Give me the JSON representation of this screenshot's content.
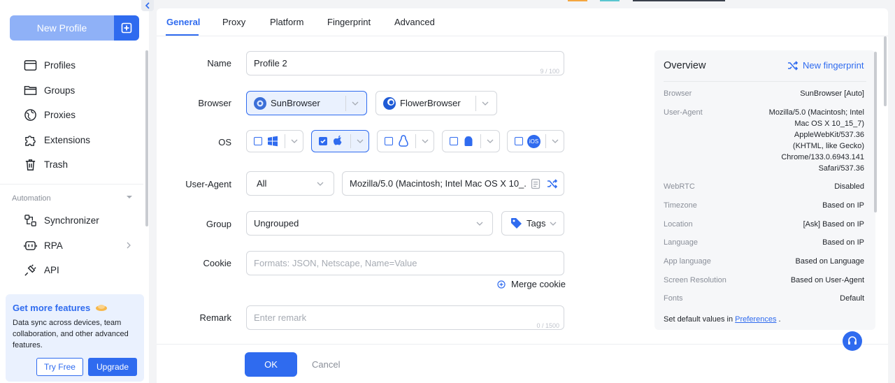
{
  "sidebar": {
    "new_profile_label": "New Profile",
    "items": [
      {
        "label": "Profiles",
        "icon": "browser-window-icon"
      },
      {
        "label": "Groups",
        "icon": "folder-icon"
      },
      {
        "label": "Proxies",
        "icon": "globe-icon"
      },
      {
        "label": "Extensions",
        "icon": "puzzle-icon"
      },
      {
        "label": "Trash",
        "icon": "trash-icon"
      }
    ],
    "automation_label": "Automation",
    "automation_items": [
      {
        "label": "Synchronizer",
        "icon": "synchronizer-icon"
      },
      {
        "label": "RPA",
        "icon": "robot-icon"
      },
      {
        "label": "API",
        "icon": "plug-icon"
      }
    ],
    "promo": {
      "title": "Get more features",
      "description": "Data sync across devices, team collaboration, and other advanced features.",
      "try_free": "Try Free",
      "upgrade": "Upgrade"
    }
  },
  "tabs": [
    "General",
    "Proxy",
    "Platform",
    "Fingerprint",
    "Advanced"
  ],
  "form": {
    "name_label": "Name",
    "name_value": "Profile 2",
    "name_count": "9 / 100",
    "browser_label": "Browser",
    "browsers": [
      "SunBrowser",
      "FlowerBrowser"
    ],
    "os_label": "OS",
    "os_options": [
      "windows-icon",
      "apple-icon",
      "linux-icon",
      "android-icon",
      "ios-icon"
    ],
    "os_ios_text": "iOS",
    "ua_label": "User-Agent",
    "ua_filter": "All",
    "ua_value": "Mozilla/5.0 (Macintosh; Intel Mac OS X 10_...",
    "group_label": "Group",
    "group_value": "Ungrouped",
    "tags_label": "Tags",
    "cookie_label": "Cookie",
    "cookie_placeholder": "Formats: JSON, Netscape, Name=Value",
    "merge_cookie": "Merge cookie",
    "remark_label": "Remark",
    "remark_placeholder": "Enter remark",
    "remark_count": "0 / 1500"
  },
  "overview": {
    "title": "Overview",
    "new_fingerprint": "New fingerprint",
    "rows": [
      {
        "label": "Browser",
        "value": "SunBrowser [Auto]"
      },
      {
        "label": "User-Agent",
        "value": "Mozilla/5.0 (Macintosh; Intel Mac OS X 10_15_7) AppleWebKit/537.36 (KHTML, like Gecko) Chrome/133.0.6943.141 Safari/537.36"
      },
      {
        "label": "WebRTC",
        "value": "Disabled"
      },
      {
        "label": "Timezone",
        "value": "Based on IP"
      },
      {
        "label": "Location",
        "value": "[Ask] Based on IP"
      },
      {
        "label": "Language",
        "value": "Based on IP"
      },
      {
        "label": "App language",
        "value": "Based on Language"
      },
      {
        "label": "Screen Resolution",
        "value": "Based on User-Agent"
      },
      {
        "label": "Fonts",
        "value": "Default"
      }
    ],
    "footer_text": "Set default values in",
    "footer_link": "Preferences",
    "footer_end": "."
  },
  "footer": {
    "ok": "OK",
    "cancel": "Cancel"
  },
  "colors": {
    "accent": "#2f6bef",
    "accent_light": "#8fb1f7"
  }
}
